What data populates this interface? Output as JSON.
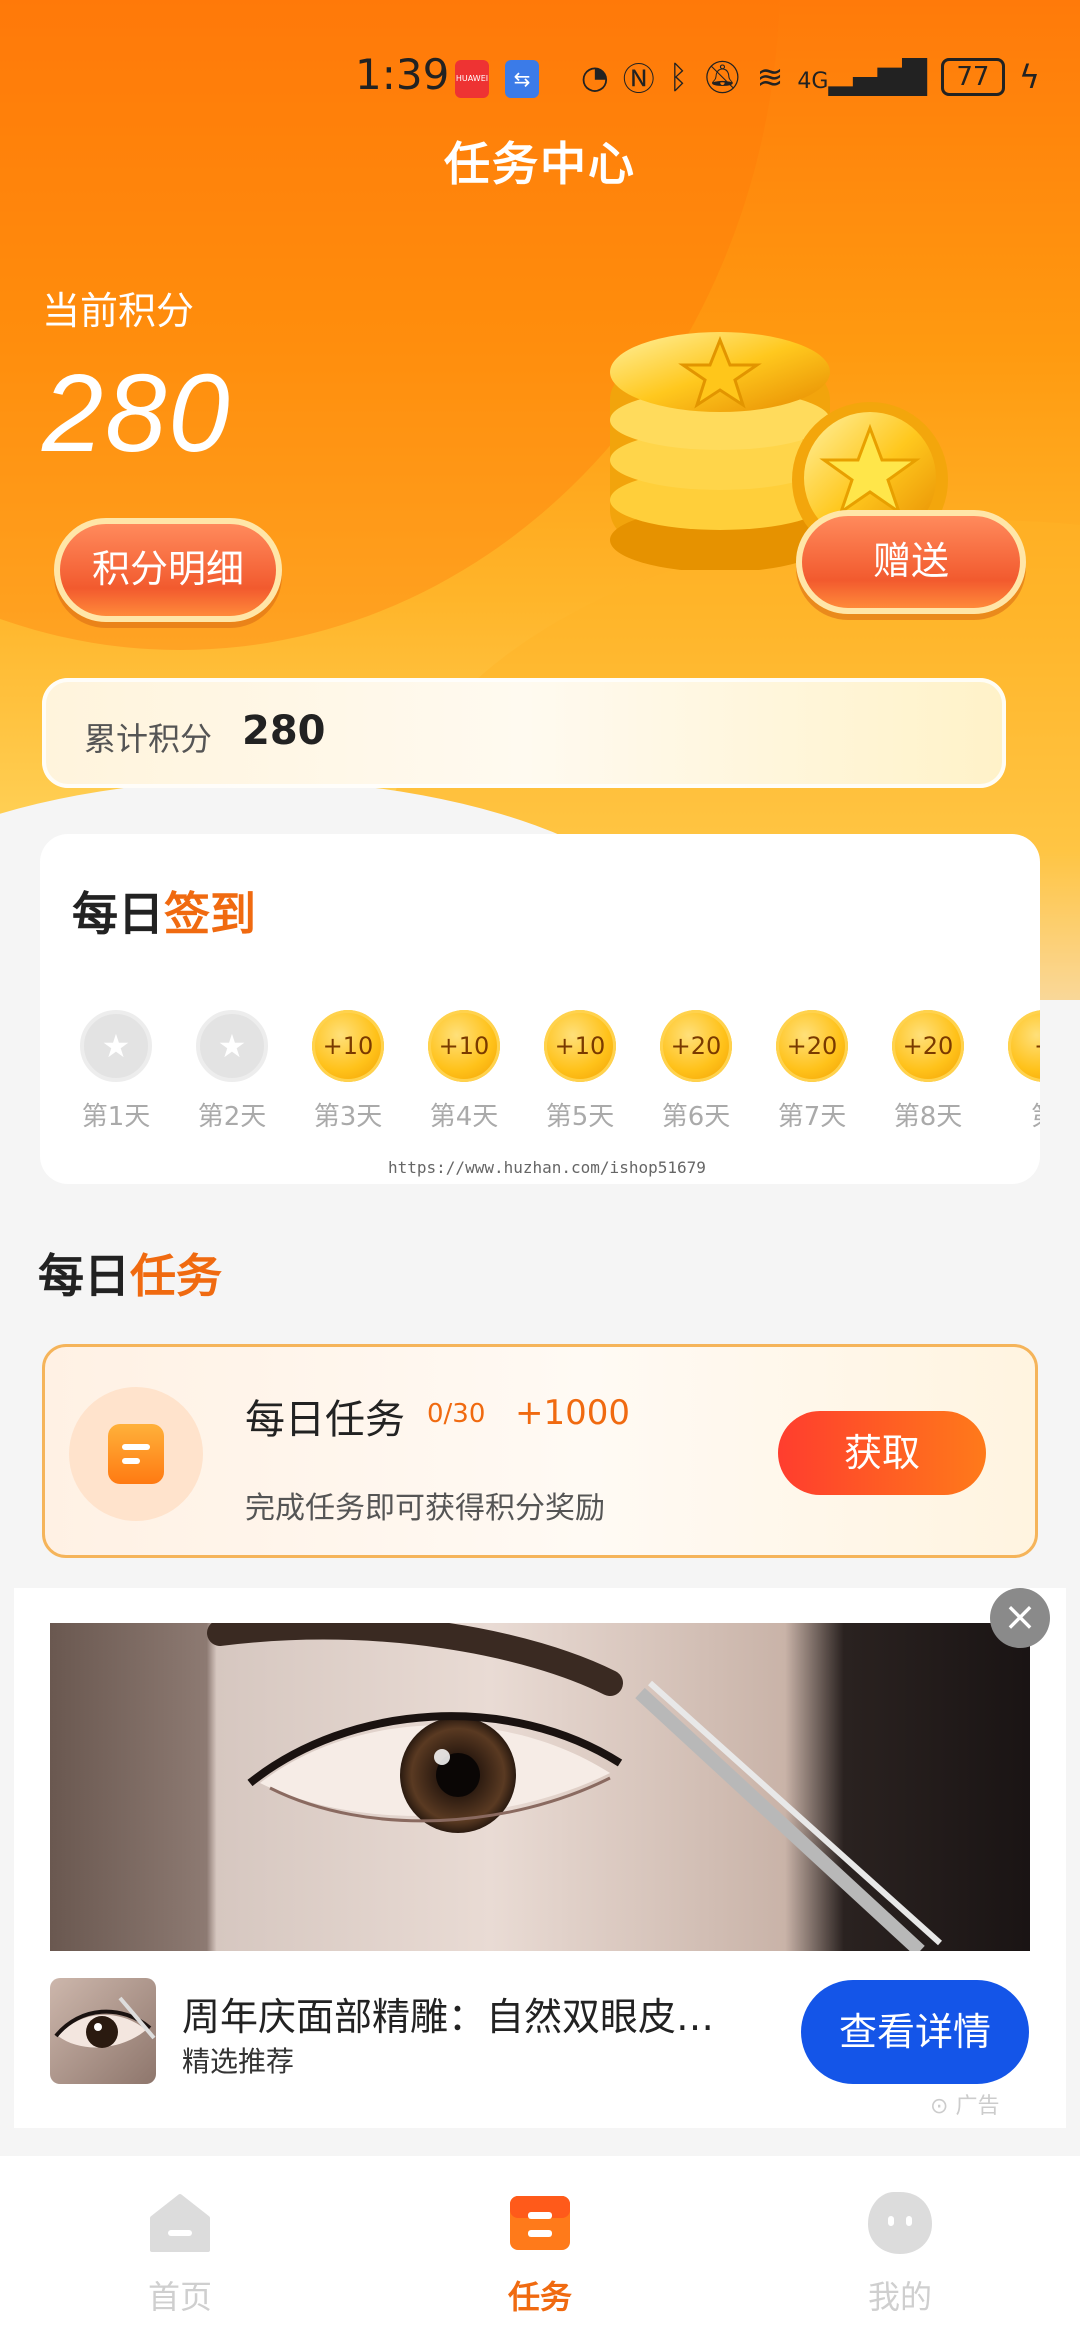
{
  "status_bar": {
    "time": "1:39",
    "huawei_label": "HUAWEI",
    "network": "4G",
    "battery": "77"
  },
  "header": {
    "title": "任务中心"
  },
  "points": {
    "label": "当前积分",
    "value": "280",
    "detail_button": "积分明细",
    "gift_button": "赠送",
    "cumulative_label": "累计积分",
    "cumulative_value": "280"
  },
  "signin": {
    "title_a": "每日",
    "title_b": "签到",
    "days": [
      {
        "label": "第1天",
        "reward": "",
        "claimed": true
      },
      {
        "label": "第2天",
        "reward": "",
        "claimed": true
      },
      {
        "label": "第3天",
        "reward": "+10",
        "claimed": false
      },
      {
        "label": "第4天",
        "reward": "+10",
        "claimed": false
      },
      {
        "label": "第5天",
        "reward": "+10",
        "claimed": false
      },
      {
        "label": "第6天",
        "reward": "+20",
        "claimed": false
      },
      {
        "label": "第7天",
        "reward": "+20",
        "claimed": false
      },
      {
        "label": "第8天",
        "reward": "+20",
        "claimed": false
      },
      {
        "label": "第",
        "reward": "+",
        "claimed": false
      }
    ]
  },
  "watermark": "https://www.huzhan.com/ishop51679",
  "daily_task": {
    "section_a": "每日",
    "section_b": "任务",
    "name": "每日任务",
    "progress": "0/30",
    "reward": "+1000",
    "description": "完成任务即可获得积分奖励",
    "button": "获取"
  },
  "ad": {
    "title": "周年庆面部精雕：自然双眼皮…",
    "subtitle": "精选推荐",
    "button": "查看详情",
    "tag": "广告"
  },
  "bottom_nav": [
    {
      "label": "首页",
      "active": false
    },
    {
      "label": "任务",
      "active": true
    },
    {
      "label": "我的",
      "active": false
    }
  ],
  "colors": {
    "accent": "#f06a10",
    "hero_top": "#ff7a0a",
    "ad_button": "#1455e8"
  }
}
